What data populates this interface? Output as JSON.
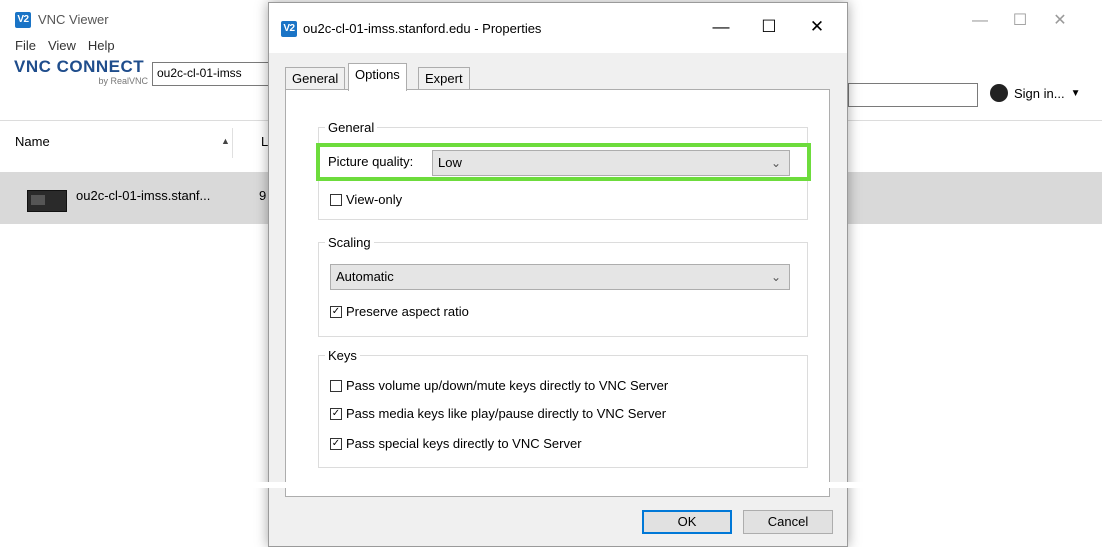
{
  "main_window": {
    "title": "VNC Viewer",
    "logo": "V2",
    "menu": [
      "File",
      "View",
      "Help"
    ],
    "brand": {
      "name": "VNC CONNECT",
      "sub": "by RealVNC"
    },
    "address_value": "ou2c-cl-01-imss",
    "sign_in_label": "Sign in...",
    "controls": {
      "minimize": "—",
      "maximize": "☐",
      "close": "✕"
    },
    "list": {
      "col_name": "Name",
      "col_next": "L",
      "row": {
        "label": "ou2c-cl-01-imss.stanf...",
        "extra": "9"
      }
    }
  },
  "dialog": {
    "logo": "V2",
    "title": "ou2c-cl-01-imss.stanford.edu - Properties",
    "controls": {
      "minimize": "—",
      "maximize": "☐",
      "close": "✕"
    },
    "tabs": [
      "General",
      "Options",
      "Expert"
    ],
    "active_tab": "Options",
    "general_group": {
      "legend": "General",
      "picture_quality_label": "Picture quality:",
      "picture_quality_value": "Low",
      "view_only_label": "View-only",
      "view_only_checked": false
    },
    "scaling_group": {
      "legend": "Scaling",
      "scaling_value": "Automatic",
      "preserve_aspect_label": "Preserve aspect ratio",
      "preserve_aspect_checked": true
    },
    "keys_group": {
      "legend": "Keys",
      "options": [
        {
          "label": "Pass volume up/down/mute keys directly to VNC Server",
          "checked": false
        },
        {
          "label": "Pass media keys like play/pause directly to VNC Server",
          "checked": true
        },
        {
          "label": "Pass special keys directly to VNC Server",
          "checked": true
        }
      ]
    },
    "buttons": {
      "ok": "OK",
      "cancel": "Cancel"
    },
    "highlight_color": "#6ddc3c"
  }
}
